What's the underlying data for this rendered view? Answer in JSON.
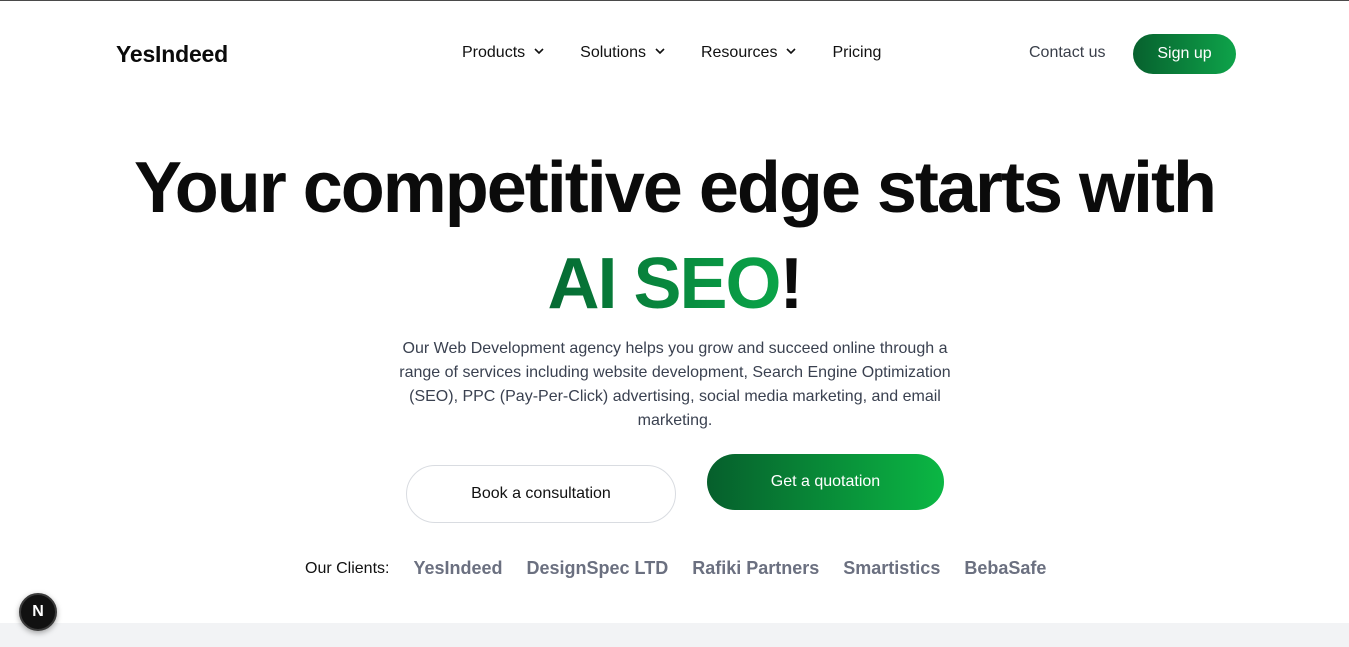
{
  "header": {
    "logo": "YesIndeed",
    "nav": [
      {
        "label": "Products",
        "has_dropdown": true
      },
      {
        "label": "Solutions",
        "has_dropdown": true
      },
      {
        "label": "Resources",
        "has_dropdown": true
      },
      {
        "label": "Pricing",
        "has_dropdown": false
      }
    ],
    "contact_label": "Contact us",
    "signup_label": "Sign up"
  },
  "hero": {
    "title_line1": "Your competitive edge starts with",
    "title_accent": "AI SEO",
    "title_suffix": "!",
    "description": "Our Web Development agency helps you grow and succeed online through a range of services including website development, Search Engine Optimization (SEO), PPC (Pay-Per-Click) advertising, social media marketing, and email marketing.",
    "secondary_cta": "Book a consultation",
    "primary_cta": "Get a quotation"
  },
  "clients": {
    "label": "Our Clients:",
    "items": [
      "YesIndeed",
      "DesignSpec LTD",
      "Rafiki Partners",
      "Smartistics",
      "BebaSafe"
    ]
  },
  "dev_badge": {
    "letter": "N",
    "icon": "nextjs-icon"
  },
  "colors": {
    "brand_green_dark": "#066a33",
    "brand_green_light": "#0bb744",
    "text_muted": "#6b7080",
    "footer_band": "#f2f3f5"
  }
}
